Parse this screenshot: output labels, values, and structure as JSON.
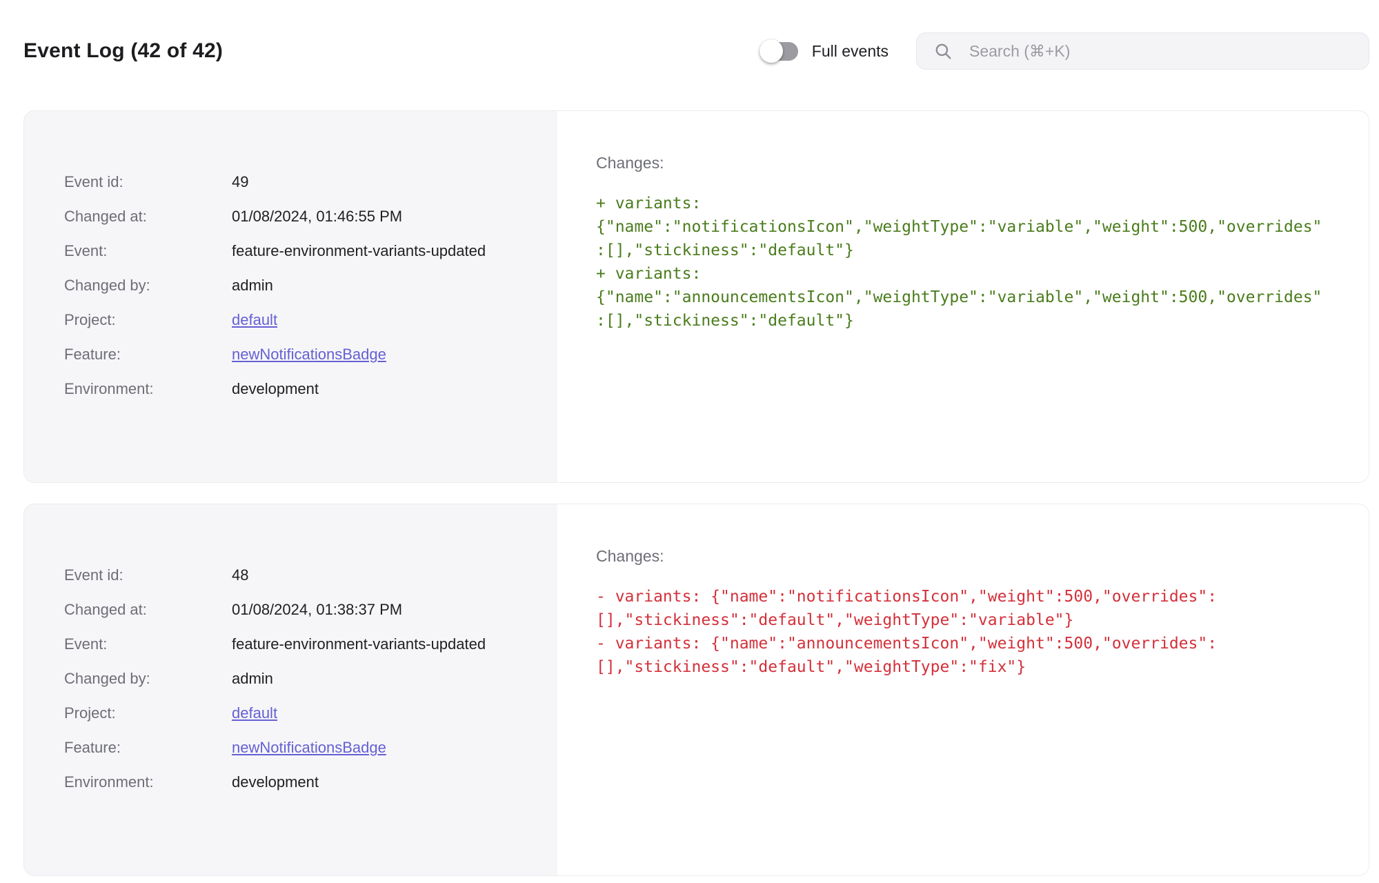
{
  "header": {
    "title": "Event Log (42 of 42)",
    "full_events_label": "Full events",
    "search_placeholder": "Search (⌘+K)"
  },
  "colors": {
    "link": "#655fd4",
    "diff_added": "#4a7c1c",
    "diff_removed": "#d3303a"
  },
  "events": [
    {
      "fields": [
        {
          "label": "Event id:",
          "value": "49"
        },
        {
          "label": "Changed at:",
          "value": "01/08/2024, 01:46:55 PM"
        },
        {
          "label": "Event:",
          "value": "feature-environment-variants-updated"
        },
        {
          "label": "Changed by:",
          "value": "admin"
        },
        {
          "label": "Project:",
          "value": "default"
        },
        {
          "label": "Feature:",
          "value": "newNotificationsBadge"
        },
        {
          "label": "Environment:",
          "value": "development"
        }
      ],
      "changes_label": "Changes:",
      "diff": {
        "kind": "added",
        "lines": [
          "+ variants:",
          "{\"name\":\"notificationsIcon\",\"weightType\":\"variable\",\"weight\":500,\"overrides\"",
          ":[],\"stickiness\":\"default\"}",
          "+ variants:",
          "{\"name\":\"announcementsIcon\",\"weightType\":\"variable\",\"weight\":500,\"overrides\"",
          ":[],\"stickiness\":\"default\"}"
        ]
      }
    },
    {
      "fields": [
        {
          "label": "Event id:",
          "value": "48"
        },
        {
          "label": "Changed at:",
          "value": "01/08/2024, 01:38:37 PM"
        },
        {
          "label": "Event:",
          "value": "feature-environment-variants-updated"
        },
        {
          "label": "Changed by:",
          "value": "admin"
        },
        {
          "label": "Project:",
          "value": "default"
        },
        {
          "label": "Feature:",
          "value": "newNotificationsBadge"
        },
        {
          "label": "Environment:",
          "value": "development"
        }
      ],
      "changes_label": "Changes:",
      "diff": {
        "kind": "removed",
        "lines": [
          "- variants: {\"name\":\"notificationsIcon\",\"weight\":500,\"overrides\":",
          "[],\"stickiness\":\"default\",\"weightType\":\"variable\"}",
          "- variants: {\"name\":\"announcementsIcon\",\"weight\":500,\"overrides\":",
          "[],\"stickiness\":\"default\",\"weightType\":\"fix\"}"
        ]
      }
    }
  ]
}
